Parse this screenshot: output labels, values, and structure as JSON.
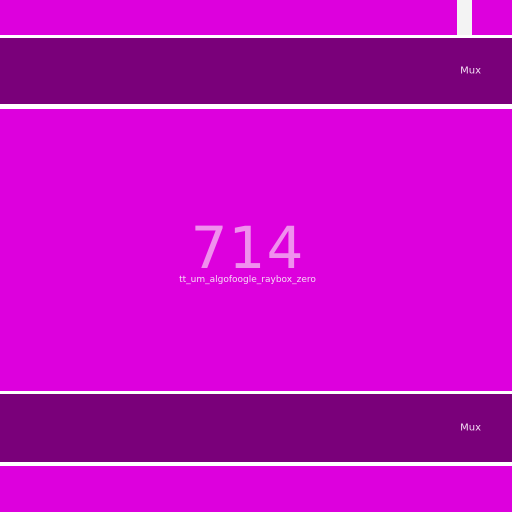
{
  "colors": {
    "magenta": "#dd00dd",
    "purple": "#7a007a",
    "separator": "#ffffff"
  },
  "rows": [
    {
      "label": "Mux"
    },
    {
      "label": "Mux"
    }
  ],
  "main": {
    "number": "714",
    "subtitle": "tt_um_algofoogle_raybox_zero"
  }
}
